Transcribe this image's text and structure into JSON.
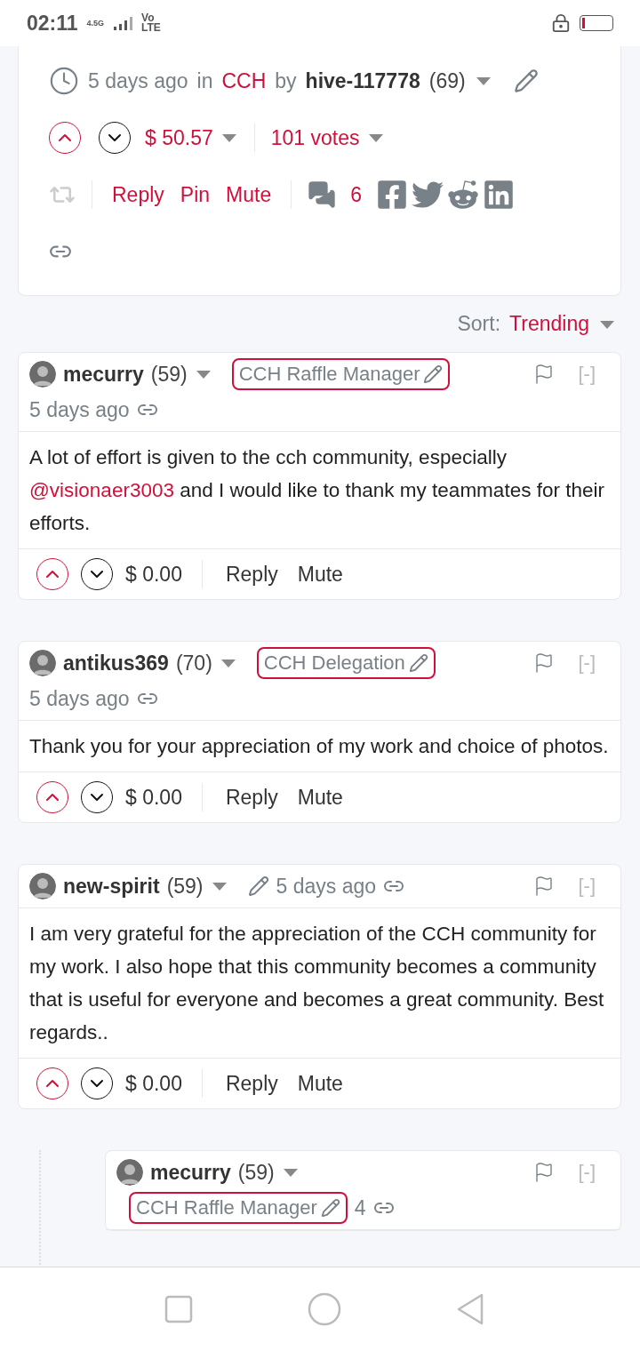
{
  "status_bar": {
    "time": "02:11",
    "network": "4.5G",
    "volte_top": "Vo",
    "volte_bottom": "LTE"
  },
  "post": {
    "time": "5 days ago",
    "in": "in",
    "community": "CCH",
    "by": "by",
    "author": "hive-117778",
    "reputation": "(69)",
    "payout": "$ 50.57",
    "votes": "101 votes",
    "actions": [
      "Reply",
      "Pin",
      "Mute"
    ],
    "comment_count": "6"
  },
  "sort": {
    "label": "Sort:",
    "value": "Trending"
  },
  "comments": [
    {
      "author": "mecurry",
      "reputation": "(59)",
      "badge": "CCH Raffle Manager",
      "time": "5 days ago",
      "collapse": "[-]",
      "nested": false,
      "body": [
        {
          "kind": "text",
          "text": "A lot of effort is given to the cch community, especially "
        },
        {
          "kind": "mention",
          "text": "@visionaer3003"
        },
        {
          "kind": "text",
          "text": " and I would like to thank my teammates for their efforts."
        }
      ],
      "payout": "$ 0.00",
      "actions": [
        "Reply",
        "Mute"
      ]
    },
    {
      "author": "antikus369",
      "reputation": "(70)",
      "badge": "CCH Delegation",
      "time": "5 days ago",
      "collapse": "[-]",
      "nested": false,
      "body": [
        {
          "kind": "text",
          "text": "Thank you for your appreciation of my work and choice of photos."
        }
      ],
      "payout": "$ 0.00",
      "actions": [
        "Reply",
        "Mute"
      ]
    },
    {
      "author": "new-spirit",
      "reputation": "(59)",
      "time": "5 days ago",
      "collapse": "[-]",
      "nested": false,
      "body": [
        {
          "kind": "text",
          "text": "I am very grateful for the appreciation of the CCH community for my work. I also hope that this community becomes a community that is useful for everyone and becomes a great community. Best regards.."
        }
      ],
      "payout": "$ 0.00",
      "actions": [
        "Reply",
        "Mute"
      ]
    },
    {
      "author": "mecurry",
      "reputation": "(59)",
      "badge": "CCH Raffle Manager",
      "time": "4",
      "collapse": "[-]",
      "nested": true
    }
  ]
}
